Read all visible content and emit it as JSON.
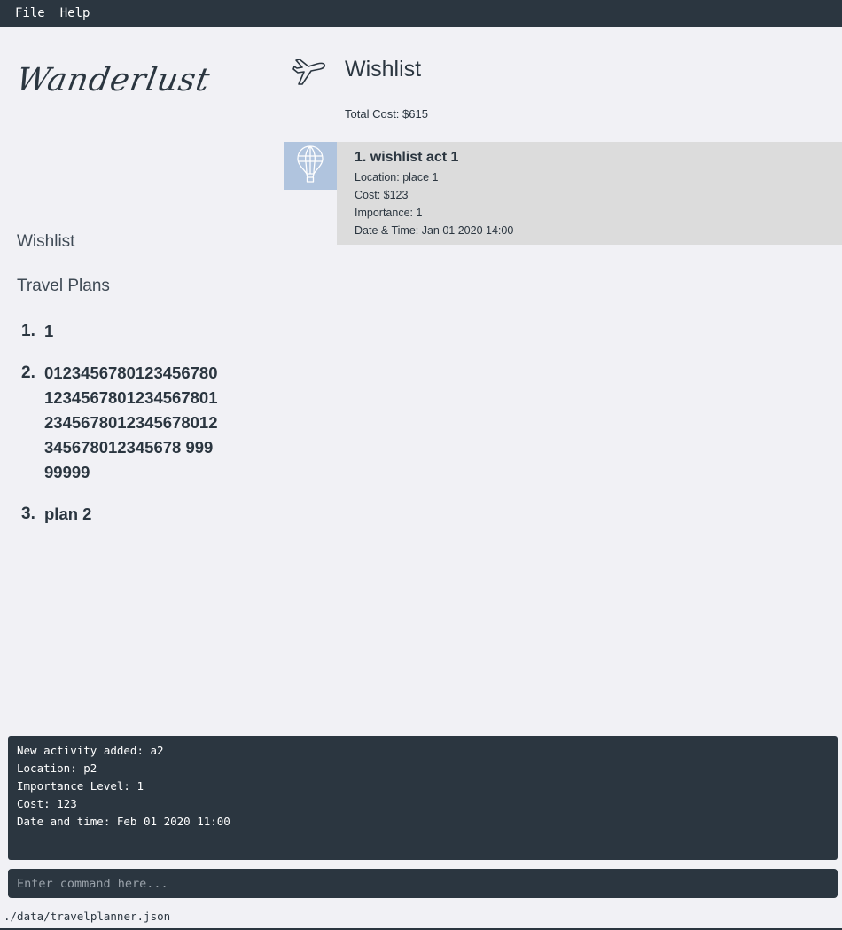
{
  "menu": {
    "file": "File",
    "help": "Help"
  },
  "logo": {
    "text": "Wanderlust"
  },
  "sidebar": {
    "wishlist_label": "Wishlist",
    "travel_plans_label": "Travel Plans",
    "plans": [
      {
        "number": "1.",
        "name": "1"
      },
      {
        "number": "2.",
        "name": "012345678012345678012345678012345678012345678012345678012345678012345678 99999999"
      },
      {
        "number": "3.",
        "name": "plan 2"
      }
    ]
  },
  "main": {
    "header_icon": "airplane-icon",
    "title": "Wishlist",
    "total_cost": "Total Cost: $615",
    "activities": [
      {
        "icon": "hot-air-balloon-icon",
        "title": "1.  wishlist act 1",
        "location": "Location: place 1",
        "cost": "Cost: $123",
        "importance": "Importance: 1",
        "datetime": "Date & Time: Jan 01 2020 14:00"
      }
    ]
  },
  "result": {
    "lines": [
      "New activity added: a2",
      "Location: p2",
      "Importance Level: 1",
      "Cost: 123",
      "Date and time: Feb 01 2020 11:00"
    ]
  },
  "command": {
    "placeholder": "Enter command here..."
  },
  "status": {
    "path": "./data/travelplanner.json"
  },
  "colors": {
    "dark": "#2b3640",
    "background": "#f1f1f5",
    "card": "#dcdcdc",
    "thumb": "#b0c4de"
  }
}
